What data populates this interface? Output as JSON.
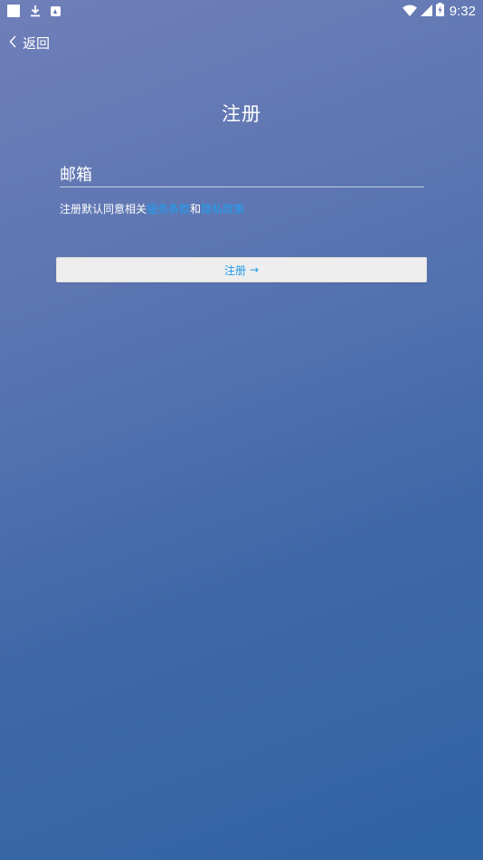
{
  "status_bar": {
    "time": "9:32",
    "left_icons": [
      "notification-square-icon",
      "download-icon",
      "app-notification-icon"
    ],
    "right_icons": [
      "wifi-icon",
      "cell-signal-icon",
      "battery-icon"
    ]
  },
  "header": {
    "back_label": "返回"
  },
  "main": {
    "title": "注册",
    "email_placeholder": "邮箱",
    "agreement": {
      "prefix": "注册默认同意相关",
      "terms_link": "服务条款",
      "conjunction": "和",
      "privacy_link": "隐私政策"
    },
    "register_button": {
      "label": "注册",
      "arrow": "→"
    }
  },
  "colors": {
    "link": "#1ea0f2",
    "button_text": "#1f9ae8",
    "button_bg": "#eeeeee",
    "gradient_top": "#6f7fb8",
    "gradient_bottom": "#2f63a4"
  }
}
